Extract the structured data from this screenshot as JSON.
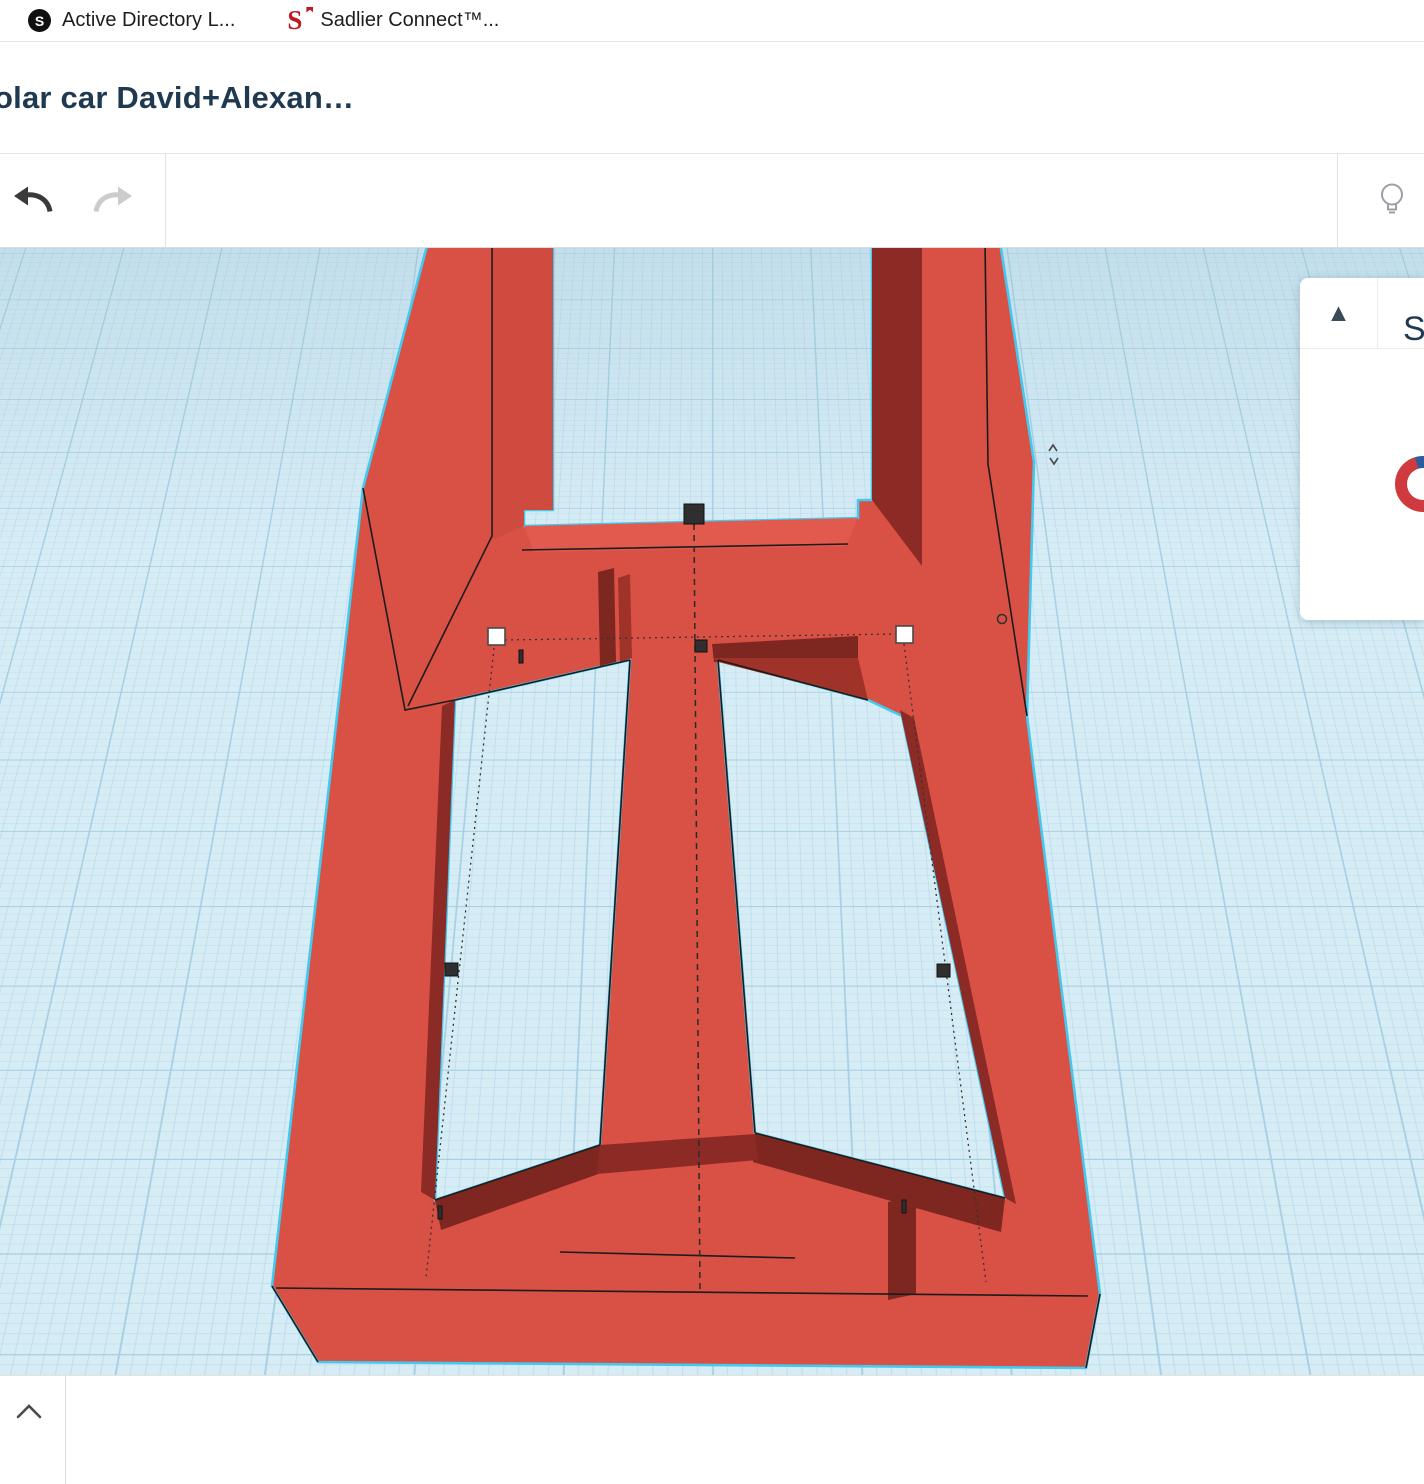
{
  "bookmarks_bar": {
    "items": [
      {
        "label": "Active Directory L...",
        "favicon_letter": "S",
        "favicon_style": "black-circle"
      },
      {
        "label": "Sadlier Connect™...",
        "favicon_letter": "S",
        "favicon_style": "red-serif-letter-with-flag"
      }
    ]
  },
  "title_bar": {
    "design_title": "olar car David+Alexan…"
  },
  "toolbar": {
    "icons": [
      {
        "name": "undo-icon",
        "enabled": true
      },
      {
        "name": "redo-icon",
        "enabled": false
      },
      {
        "name": "lightbulb-icon",
        "enabled": true
      }
    ]
  },
  "viewport": {
    "model_name": "solar-car-chassis",
    "colors": {
      "grid_bg": "#d7edf6",
      "grid_line": "#bcdcec",
      "grid_major_line": "#a6cfe2",
      "model_red": "#d95045",
      "model_red_light": "#e25a4e",
      "model_red_shade": "#cf4a3f",
      "model_red_dark": "#8c2b26",
      "model_red_darker": "#7e2620",
      "selection_outline": "#45c8ee",
      "handle_white": "#ffffff",
      "handle_dark": "#2f2f2f"
    }
  },
  "right_panel": {
    "collapse_glyph": "▲",
    "title_partial": "S"
  },
  "bottom_bar": {
    "icon": "chevron-up"
  }
}
